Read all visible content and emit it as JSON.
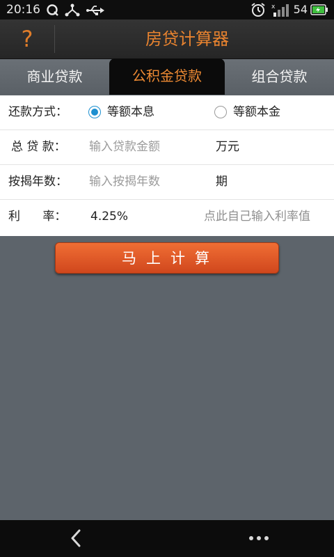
{
  "status_bar": {
    "time": "20:16",
    "battery": "54",
    "icons_left": [
      "q-icon",
      "share-nodes-icon",
      "usb-icon"
    ],
    "icons_right": [
      "alarm-clock-icon",
      "signal-icon",
      "battery-icon"
    ]
  },
  "header": {
    "help_label": "?",
    "title": "房贷计算器"
  },
  "tabs": [
    {
      "label": "商业贷款",
      "active": false
    },
    {
      "label": "公积金贷款",
      "active": true
    },
    {
      "label": "组合贷款",
      "active": false
    }
  ],
  "form": {
    "repay_method_label": "还款方式：",
    "repay_options": [
      {
        "label": "等额本息",
        "checked": true
      },
      {
        "label": "等额本金",
        "checked": false
      }
    ],
    "loan_amount_label": "总 贷  款：",
    "loan_amount_placeholder": "输入贷款金额",
    "loan_amount_value": "",
    "loan_amount_unit": "万元",
    "term_label": "按揭年数：",
    "term_placeholder": "输入按揭年数",
    "term_value": "",
    "term_unit": "期",
    "rate_label": "利      率：",
    "rate_value": "4.25%",
    "rate_link": "点此自己输入利率值"
  },
  "calculate_button": "马上计算",
  "nav_bar": {
    "back_icon": "chevron-left-icon",
    "more_icon": "more-dots-icon"
  },
  "colors": {
    "accent_orange": "#e8832f",
    "button_orange": "#e05a28",
    "radio_blue": "#1c8fd0",
    "background_gray": "#5d646b"
  }
}
